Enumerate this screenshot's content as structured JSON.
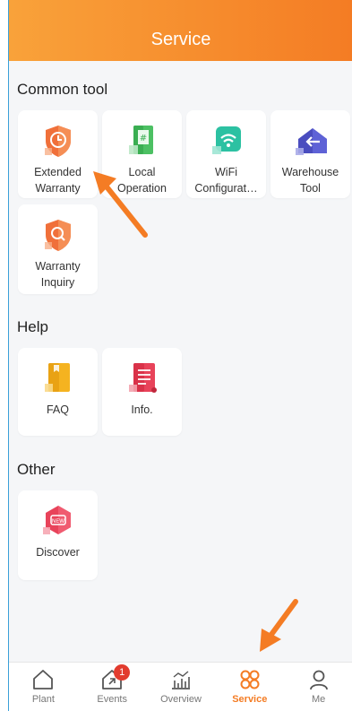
{
  "header": {
    "title": "Service"
  },
  "sections": [
    {
      "title": "Common tool",
      "items": [
        {
          "label": "Extended\nWarranty",
          "icon": "extended-warranty-icon"
        },
        {
          "label": "Local\nOperation",
          "icon": "local-operation-icon"
        },
        {
          "label": "WiFi\nConfigurat…",
          "icon": "wifi-configuration-icon"
        },
        {
          "label": "Warehouse\nTool",
          "icon": "warehouse-tool-icon"
        },
        {
          "label": "Warranty\nInquiry",
          "icon": "warranty-inquiry-icon"
        }
      ]
    },
    {
      "title": "Help",
      "items": [
        {
          "label": "FAQ",
          "icon": "faq-icon"
        },
        {
          "label": "Info.",
          "icon": "info-icon"
        }
      ]
    },
    {
      "title": "Other",
      "items": [
        {
          "label": "Discover",
          "icon": "discover-icon"
        }
      ]
    }
  ],
  "tabbar": {
    "tabs": [
      {
        "label": "Plant",
        "icon": "home-icon"
      },
      {
        "label": "Events",
        "icon": "events-icon",
        "badge": "1"
      },
      {
        "label": "Overview",
        "icon": "chart-icon"
      },
      {
        "label": "Service",
        "icon": "service-icon",
        "active": true
      },
      {
        "label": "Me",
        "icon": "user-icon"
      }
    ]
  },
  "colors": {
    "accent": "#f47c24",
    "header_start": "#f9a23a",
    "badge": "#e23b2e"
  }
}
